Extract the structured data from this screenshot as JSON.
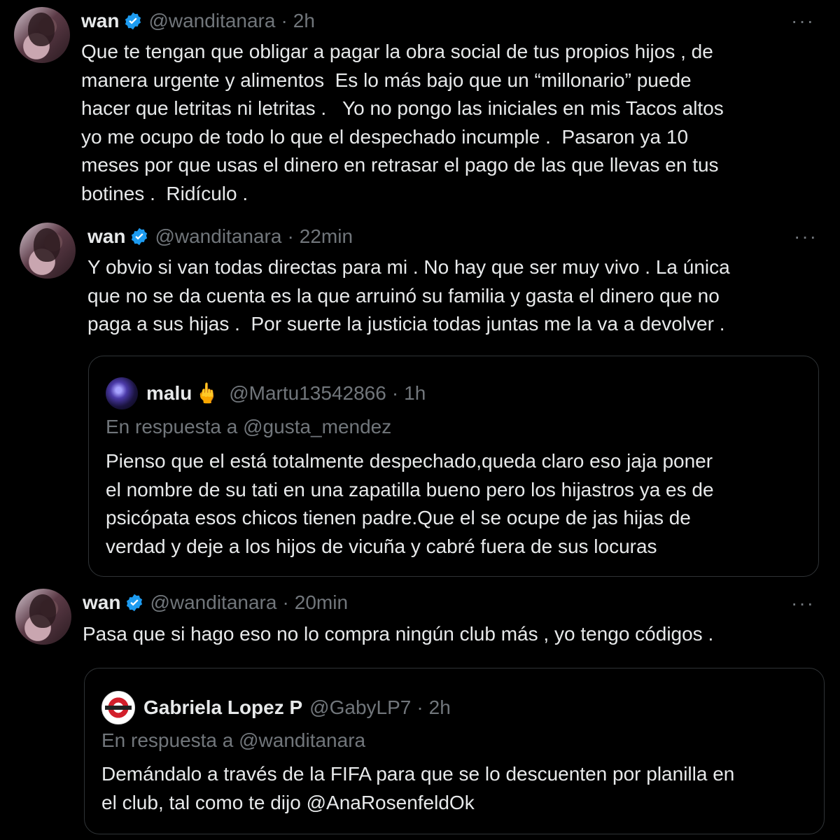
{
  "tweets": [
    {
      "name": "wan",
      "handle": "@wanditanara",
      "time": "2h",
      "more": "···",
      "text": "Que te tengan que obligar a pagar la obra social de tus propios hijos , de\nmanera urgente y alimentos  Es lo más bajo que un “millonario” puede\nhacer que letritas ni letritas .   Yo no pongo las iniciales en mis Tacos altos\nyo me ocupo de todo lo que el despechado incumple .  Pasaron ya 10\nmeses por que usas el dinero en retrasar el pago de las que llevas en tus\nbotines .  Ridículo ."
    },
    {
      "name": "wan",
      "handle": "@wanditanara",
      "time": "22min",
      "more": "···",
      "text": "Y obvio si van todas directas para mi . No hay que ser muy vivo . La única\nque no se da cuenta es la que arruinó su familia y gasta el dinero que no\npaga a sus hijas .  Por suerte la justicia todas juntas me la va a devolver .",
      "quote": {
        "name": "malu",
        "emoji": "🖕",
        "handle": "@Martu13542866",
        "time": "1h",
        "reply_to": "En respuesta a @gusta_mendez",
        "text": "Pienso que el está totalmente despechado,queda claro eso jaja poner\nel nombre de su tati en una zapatilla bueno pero los hijastros ya es de\npsicópata esos chicos tienen padre.Que el se ocupe de jas hijas de\nverdad y deje a los hijos de vicuña y cabré fuera de sus locuras"
      }
    },
    {
      "name": "wan",
      "handle": "@wanditanara",
      "time": "20min",
      "more": "···",
      "text": "Pasa que si hago eso no lo compra ningún club más , yo tengo códigos .",
      "quote": {
        "name": "Gabriela Lopez P",
        "handle": "@GabyLP7",
        "time": "2h",
        "reply_to": "En respuesta a @wanditanara",
        "text": "Demándalo a través de la FIFA para que se lo descuenten por planilla en\nel club, tal como te dijo @AnaRosenfeldOk"
      }
    }
  ],
  "separator": "·",
  "colors": {
    "background": "#000000",
    "text": "#e7e9ea",
    "secondary": "#71767b",
    "verified": "#1d9bf0",
    "border": "#2f3336"
  }
}
